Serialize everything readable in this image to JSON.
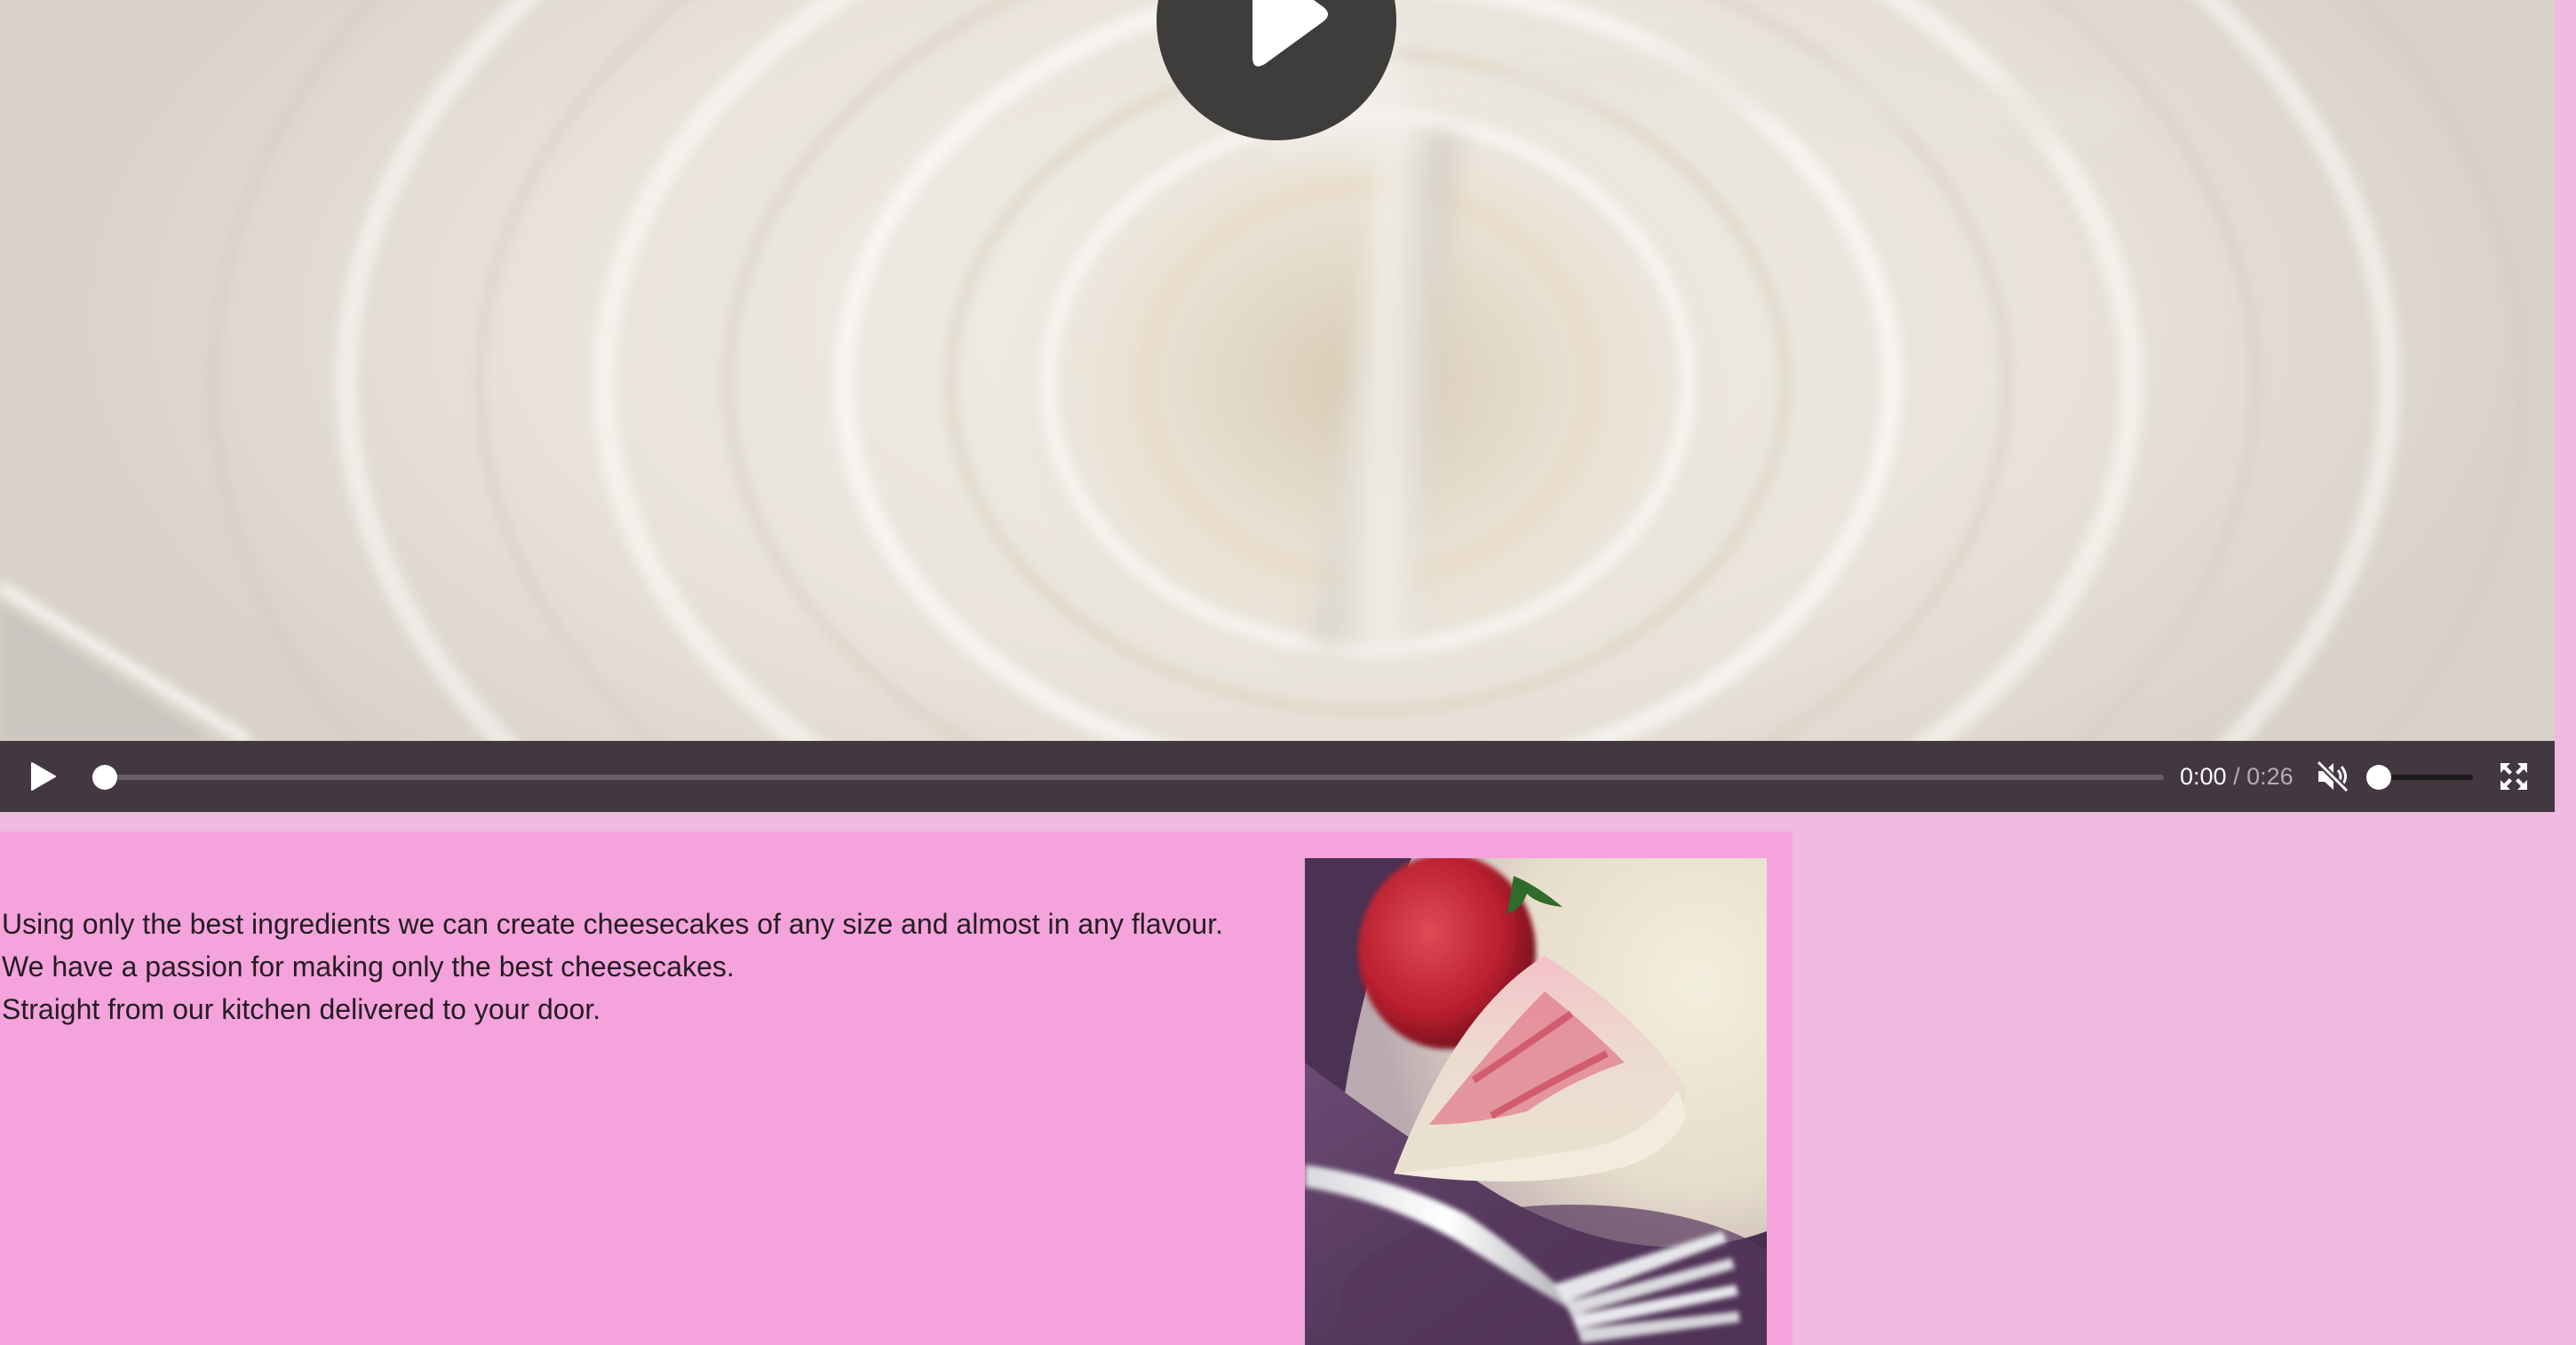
{
  "video": {
    "play_overlay_icon": "play-icon",
    "controls": {
      "play_icon": "play-icon",
      "current_time": "0:00",
      "separator": " / ",
      "duration": "0:26",
      "progress_fraction": 0,
      "mute_icon": "speaker-muted-icon",
      "volume_fraction": 0,
      "fullscreen_icon": "fullscreen-icon"
    }
  },
  "content": {
    "lines": [
      "Using only the best ingredients we can create cheesecakes of any size and almost in any flavour.",
      "We have a passion for making only the best cheesecakes.",
      "Straight from our kitchen delivered to your door."
    ]
  },
  "colors": {
    "page_background": "#eebae0",
    "section_background": "#f4a3dc",
    "controls_bar": "#433740",
    "text": "#241d22"
  }
}
